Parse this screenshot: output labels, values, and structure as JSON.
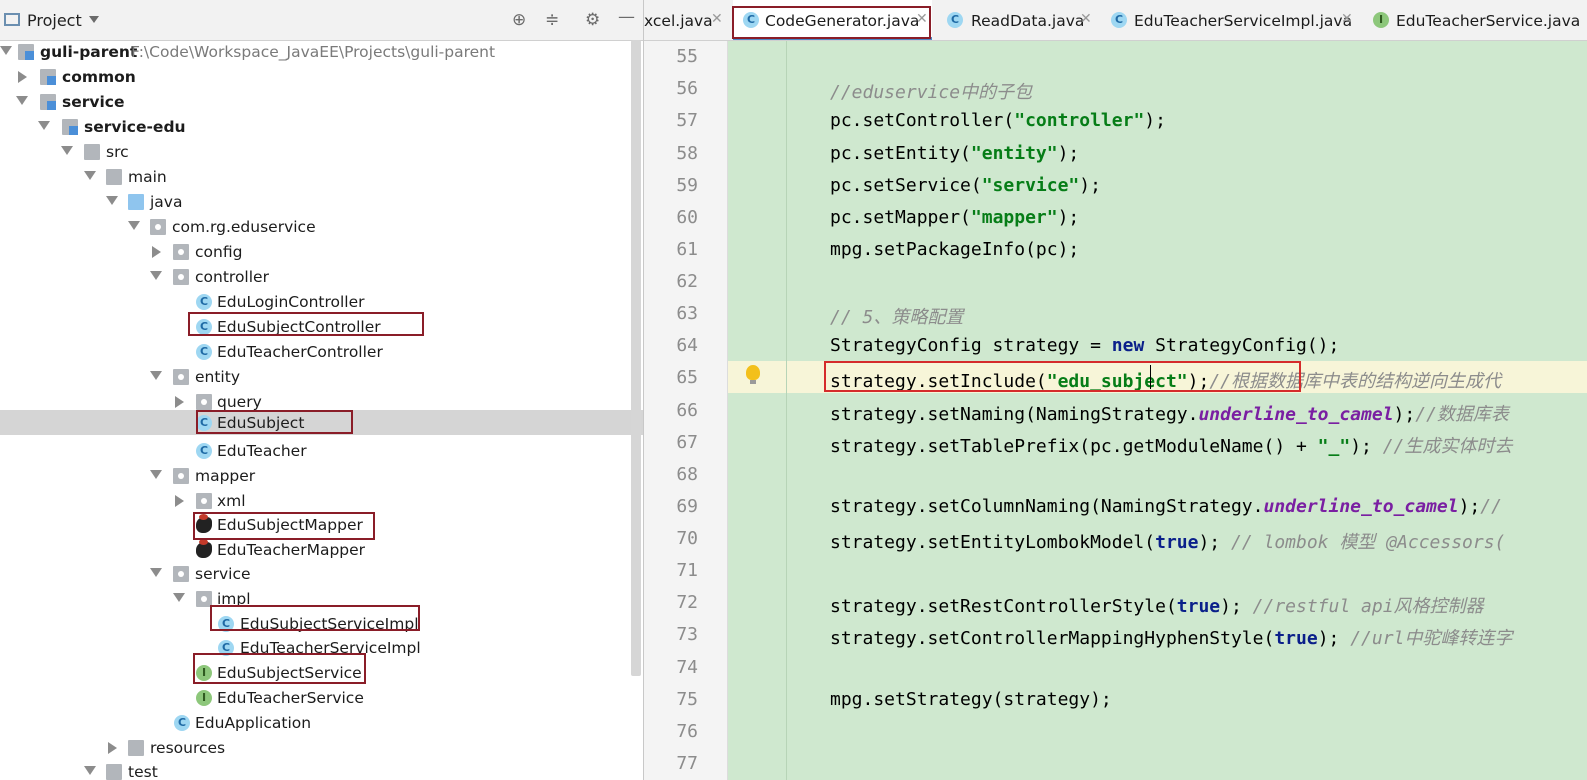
{
  "project_panel": {
    "title": "Project",
    "tree": [
      {
        "label": "guli-parent",
        "path": "F:\\Code\\Workspace_JavaEE\\Projects\\guli-parent"
      },
      {
        "label": "common"
      },
      {
        "label": "service"
      },
      {
        "label": "service-edu"
      },
      {
        "label": "src"
      },
      {
        "label": "main"
      },
      {
        "label": "java"
      },
      {
        "label": "com.rg.eduservice"
      },
      {
        "label": "config"
      },
      {
        "label": "controller"
      },
      {
        "label": "EduLoginController"
      },
      {
        "label": "EduSubjectController"
      },
      {
        "label": "EduTeacherController"
      },
      {
        "label": "entity"
      },
      {
        "label": "query"
      },
      {
        "label": "EduSubject"
      },
      {
        "label": "EduTeacher"
      },
      {
        "label": "mapper"
      },
      {
        "label": "xml"
      },
      {
        "label": "EduSubjectMapper"
      },
      {
        "label": "EduTeacherMapper"
      },
      {
        "label": "service"
      },
      {
        "label": "impl"
      },
      {
        "label": "EduSubjectServiceImpl"
      },
      {
        "label": "EduTeacherServiceImpl"
      },
      {
        "label": "EduSubjectService"
      },
      {
        "label": "EduTeacherService"
      },
      {
        "label": "EduApplication"
      },
      {
        "label": "resources"
      },
      {
        "label": "test"
      }
    ]
  },
  "editor": {
    "tabs": [
      {
        "label": "xcel.java"
      },
      {
        "label": "CodeGenerator.java"
      },
      {
        "label": "ReadData.java"
      },
      {
        "label": "EduTeacherServiceImpl.java"
      },
      {
        "label": "EduTeacherService.java"
      }
    ],
    "line_numbers": [
      "55",
      "56",
      "57",
      "58",
      "59",
      "60",
      "61",
      "62",
      "63",
      "64",
      "65",
      "66",
      "67",
      "68",
      "69",
      "70",
      "71",
      "72",
      "73",
      "74",
      "75",
      "76",
      "77"
    ],
    "code": {
      "l56": "//eduservice中的子包",
      "l57a": "pc.setController(",
      "l57s": "\"controller\"",
      "l57b": ");",
      "l58a": "pc.setEntity(",
      "l58s": "\"entity\"",
      "l58b": ");",
      "l59a": "pc.setService(",
      "l59s": "\"service\"",
      "l59b": ");",
      "l60a": "pc.setMapper(",
      "l60s": "\"mapper\"",
      "l60b": ");",
      "l61": "mpg.setPackageInfo(pc);",
      "l63": "// 5、策略配置",
      "l64a": "StrategyConfig strategy = ",
      "l64k": "new",
      "l64b": " StrategyConfig();",
      "l65a": "strategy.setInclude(",
      "l65s": "\"edu_subject\"",
      "l65b": ");",
      "l65c": "//根据数据库中表的结构逆向生成代",
      "l66a": "strategy.setNaming(NamingStrategy.",
      "l66st": "underline_to_camel",
      "l66b": ");",
      "l66c": "//数据库表",
      "l67a": "strategy.setTablePrefix(pc.getModuleName() + ",
      "l67s": "\"_\"",
      "l67b": "); ",
      "l67c": "//生成实体时去",
      "l69a": "strategy.setColumnNaming(NamingStrategy.",
      "l69st": "underline_to_camel",
      "l69b": ");",
      "l69c": "//",
      "l70a": "strategy.setEntityLombokModel(",
      "l70k": "true",
      "l70b": "); ",
      "l70c": "// lombok 模型 @Accessors(",
      "l72a": "strategy.setRestControllerStyle(",
      "l72k": "true",
      "l72b": "); ",
      "l72c": "//restful api风格控制器",
      "l73a": "strategy.setControllerMappingHyphenStyle(",
      "l73k": "true",
      "l73b": "); ",
      "l73c": "//url中驼峰转连字",
      "l75": "mpg.setStrategy(strategy);"
    }
  }
}
